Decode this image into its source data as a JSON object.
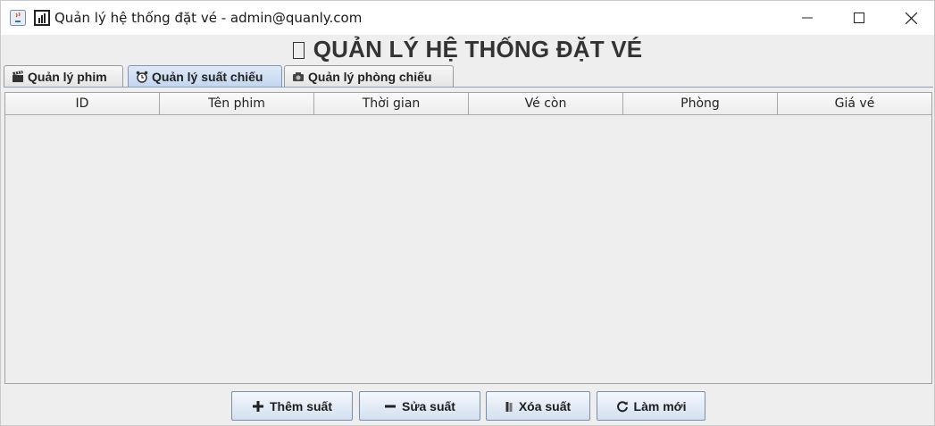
{
  "window": {
    "title": "Quản lý hệ thống đặt vé - admin@quanly.com",
    "icons": [
      "java-icon",
      "bar-chart-icon"
    ],
    "controls": [
      "minimize-icon",
      "maximize-icon",
      "close-icon"
    ]
  },
  "header": {
    "title": "QUẢN LÝ HỆ THỐNG ĐẶT VÉ"
  },
  "tabs": [
    {
      "label": "Quản lý phim",
      "icon": "clapperboard-icon",
      "active": false
    },
    {
      "label": "Quản lý suất chiếu",
      "icon": "alarm-clock-icon",
      "active": true
    },
    {
      "label": "Quản lý phòng chiếu",
      "icon": "camera-icon",
      "active": false
    }
  ],
  "table": {
    "columns": [
      "ID",
      "Tên phim",
      "Thời gian",
      "Vé còn",
      "Phòng",
      "Giá vé"
    ],
    "rows": []
  },
  "actions": {
    "add_label": "Thêm suất",
    "edit_label": "Sửa suất",
    "delete_label": "Xóa suất",
    "refresh_label": "Làm mới"
  }
}
